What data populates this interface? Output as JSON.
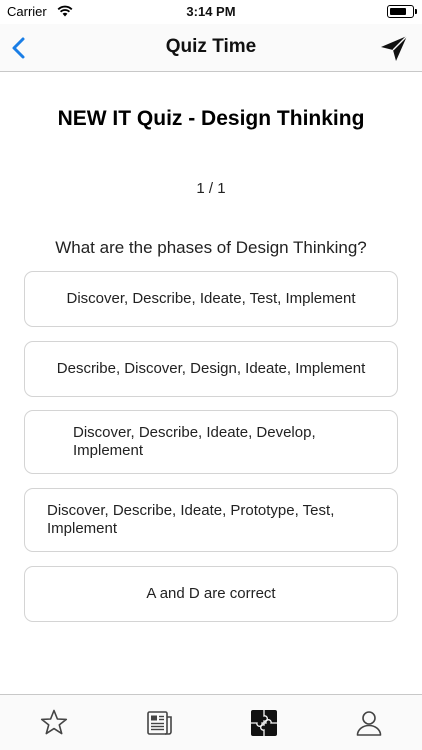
{
  "status_bar": {
    "carrier": "Carrier",
    "time": "3:14 PM",
    "battery_level": 0.8
  },
  "nav": {
    "title": "Quiz Time",
    "back_icon": "chevron-left-icon",
    "send_icon": "paper-plane-icon",
    "accent_color": "#1a7ee6"
  },
  "quiz": {
    "title": "NEW IT Quiz - Design Thinking",
    "progress": "1 / 1",
    "question": "What are the phases of Design Thinking?",
    "answers": [
      "Discover, Describe, Ideate, Test, Implement",
      "Describe, Discover, Design, Ideate, Implement",
      "Discover, Describe, Ideate, Develop, Implement",
      "Discover, Describe, Ideate, Prototype, Test, Implement",
      "A and D are correct"
    ]
  },
  "tab_bar": {
    "tabs": [
      {
        "icon": "star-icon"
      },
      {
        "icon": "newspaper-icon"
      },
      {
        "icon": "puzzle-icon",
        "selected": true
      },
      {
        "icon": "person-icon"
      }
    ]
  }
}
